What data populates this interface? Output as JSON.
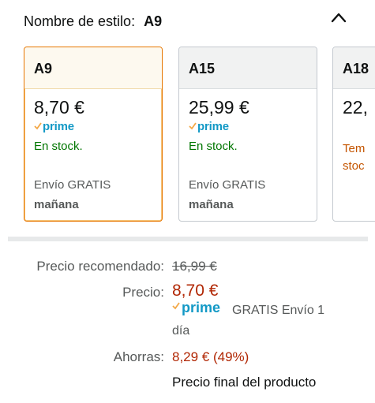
{
  "header": {
    "label": "Nombre de estilo:",
    "value": "A9"
  },
  "icons": {
    "collapse": "chevron-up-icon",
    "prime_check": "check-icon"
  },
  "colors": {
    "selected_border": "#e77600",
    "prime": "#1399c6",
    "in_stock": "#007600",
    "low_stock": "#c45500",
    "price_red": "#b12704"
  },
  "cards": [
    {
      "name": "A9",
      "price": "8,70 €",
      "prime": "prime",
      "stock": "En stock.",
      "shipping": "Envío GRATIS",
      "delivery": "mañana",
      "selected": true
    },
    {
      "name": "A15",
      "price": "25,99 €",
      "prime": "prime",
      "stock": "En stock.",
      "shipping": "Envío GRATIS",
      "delivery": "mañana",
      "selected": false
    },
    {
      "name": "A18",
      "price": "22,",
      "stock_line1": "Tem",
      "stock_line2": "stoc",
      "selected": false
    }
  ],
  "pricing": {
    "recommended_label": "Precio recomendado:",
    "recommended_value": "16,99 €",
    "price_label": "Precio:",
    "price_value": "8,70 €",
    "prime": "prime",
    "free_shipping": "GRATIS Envío 1",
    "free_shipping_cont": "día",
    "savings_label": "Ahorras:",
    "savings_value": "8,29 € (49%)",
    "final_note": "Precio final del producto"
  }
}
